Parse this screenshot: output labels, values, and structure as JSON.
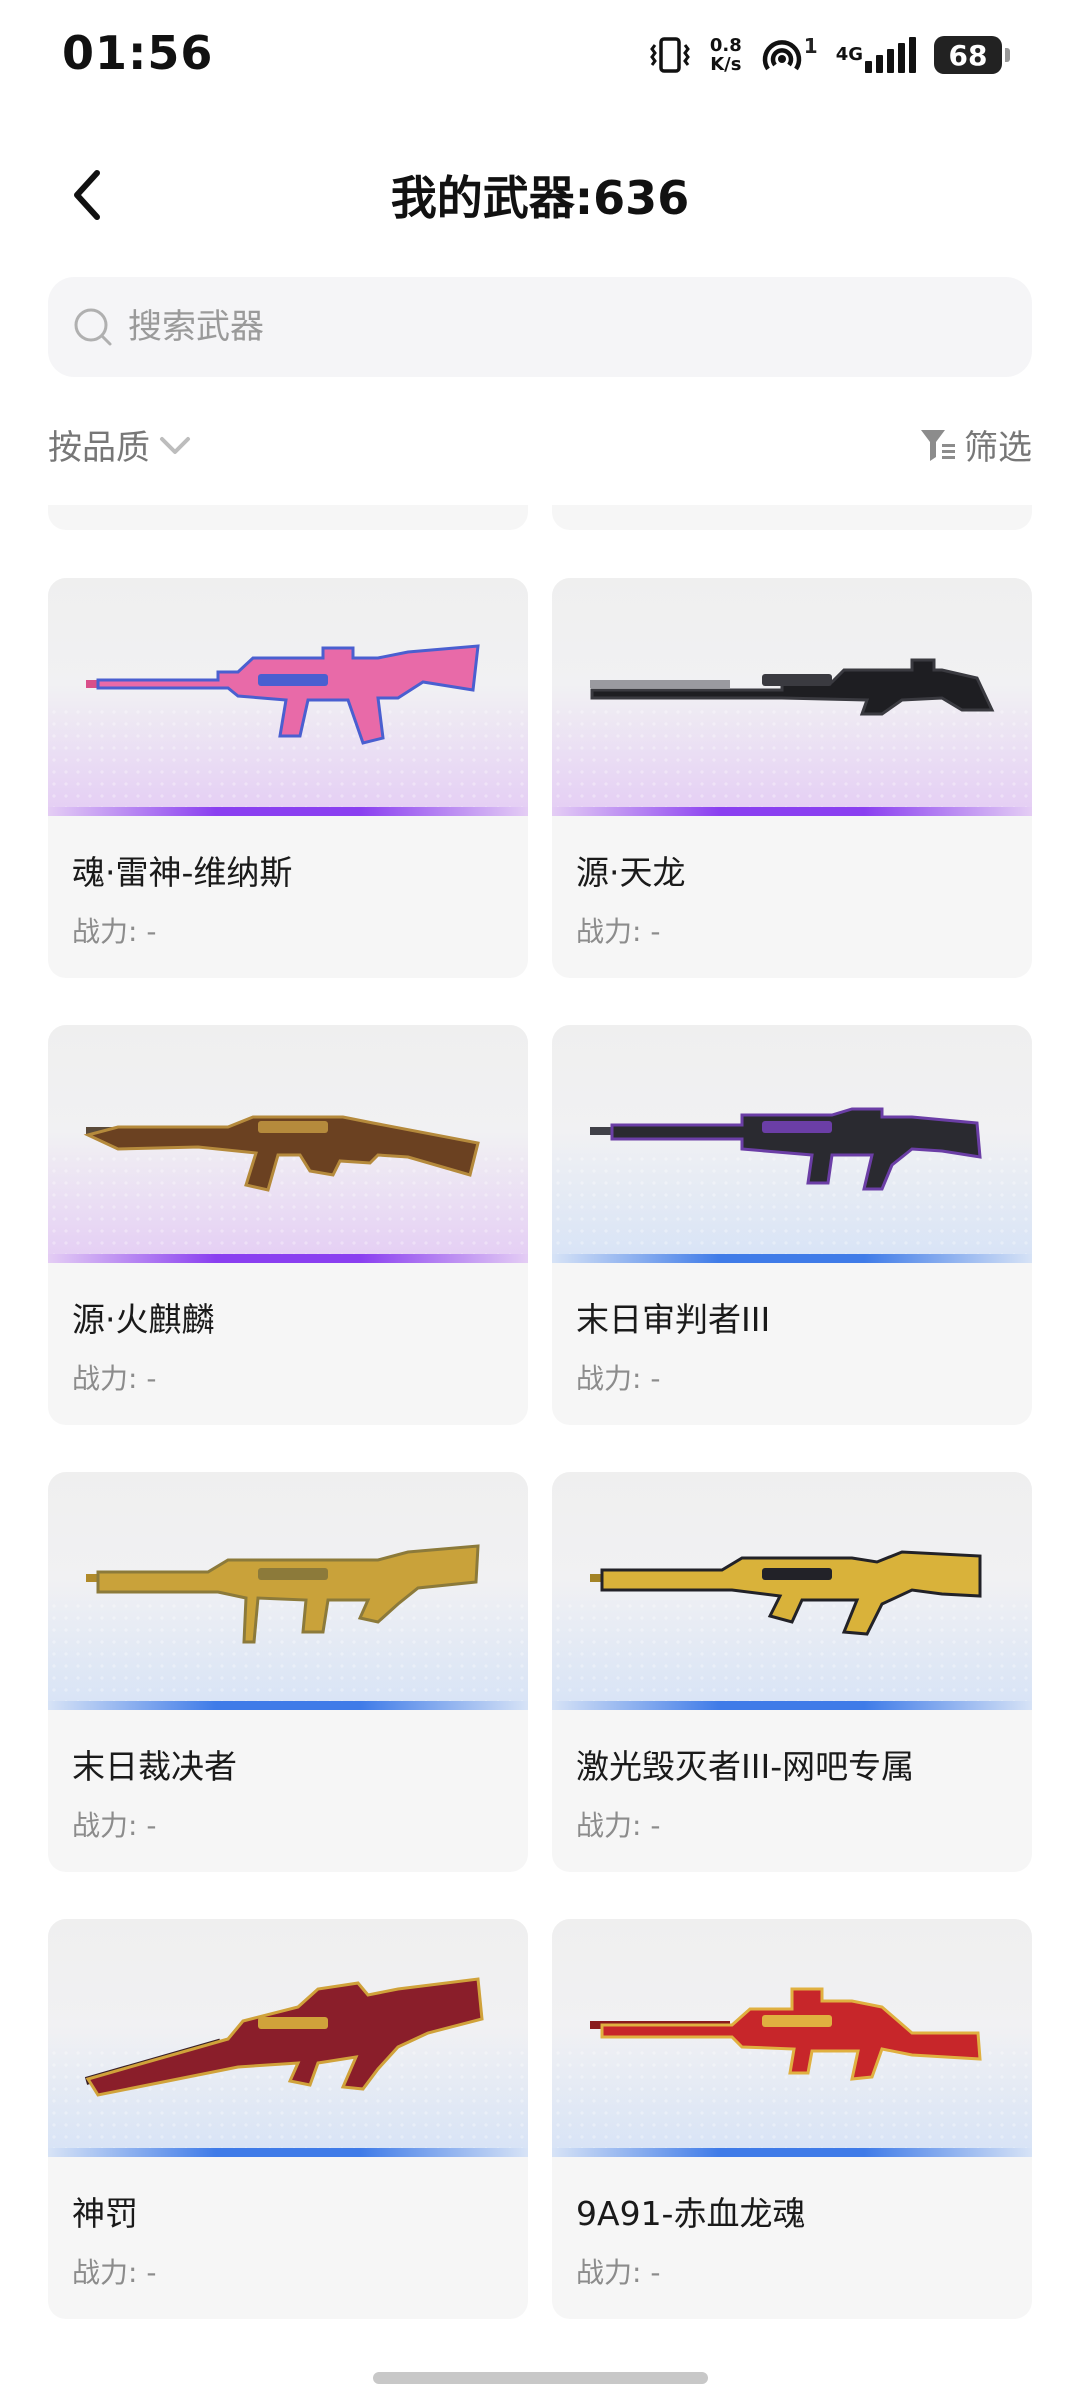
{
  "status_bar": {
    "time": "01:56",
    "net_speed_value": "0.8",
    "net_speed_unit": "K/s",
    "hotspot_count": "1",
    "network_type": "4G",
    "battery": "68",
    "icons": [
      "vibrate-icon",
      "hotspot-icon",
      "signal-icon",
      "battery-icon"
    ]
  },
  "header": {
    "title": "我的武器:636",
    "back_icon": "chevron-left-icon"
  },
  "search": {
    "placeholder": "搜索武器",
    "value": ""
  },
  "toolbar": {
    "sort_label": "按品质",
    "filter_label": "筛选"
  },
  "colors": {
    "legendary_tint": "#e4cdf4",
    "legendary_stripe": "#8a3ff0",
    "epic_tint": "#d7e3f6",
    "epic_stripe": "#3f7be8",
    "card_bg": "#f6f6f6"
  },
  "weapons": [
    {
      "name": "魂·雷神-维纳斯",
      "power": "战力: -",
      "rarity": "legendary",
      "icon": "assault-rifle-icon"
    },
    {
      "name": "源·天龙",
      "power": "战力: -",
      "rarity": "legendary",
      "icon": "sniper-rifle-icon"
    },
    {
      "name": "源·火麒麟",
      "power": "战力: -",
      "rarity": "legendary",
      "icon": "ak-rifle-icon"
    },
    {
      "name": "末日审判者III",
      "power": "战力: -",
      "rarity": "epic",
      "icon": "battle-rifle-icon"
    },
    {
      "name": "末日裁决者",
      "power": "战力: -",
      "rarity": "epic",
      "icon": "machine-gun-icon"
    },
    {
      "name": "激光毁灭者III-网吧专属",
      "power": "战力: -",
      "rarity": "epic",
      "icon": "laser-rifle-icon"
    },
    {
      "name": "神罚",
      "power": "战力: -",
      "rarity": "epic",
      "icon": "scoped-rifle-icon"
    },
    {
      "name": "9A91-赤血龙魂",
      "power": "战力: -",
      "rarity": "epic",
      "icon": "carbine-icon"
    }
  ]
}
